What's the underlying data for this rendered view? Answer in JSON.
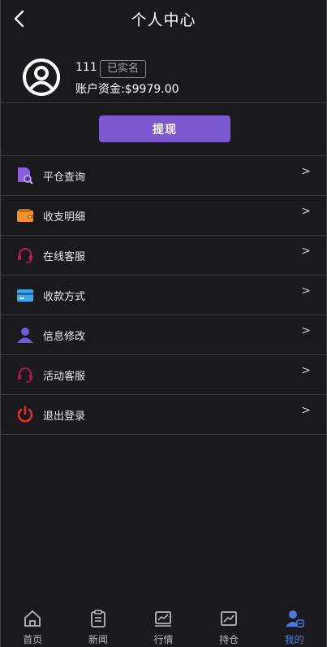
{
  "header": {
    "title": "个人中心"
  },
  "profile": {
    "user_id": "111",
    "verify_status": "已实名",
    "balance_text": "账户资金:$9979.00"
  },
  "actions": {
    "withdraw_label": "提现"
  },
  "menu": {
    "arrow": ">",
    "items": [
      {
        "label": "平仓查询",
        "icon": "search-document-icon"
      },
      {
        "label": "收支明细",
        "icon": "wallet-icon"
      },
      {
        "label": "在线客服",
        "icon": "headset-icon"
      },
      {
        "label": "收款方式",
        "icon": "credit-card-icon"
      },
      {
        "label": "信息修改",
        "icon": "user-icon"
      },
      {
        "label": "活动客服",
        "icon": "headset-icon"
      },
      {
        "label": "退出登录",
        "icon": "power-icon"
      }
    ]
  },
  "tabbar": {
    "tabs": [
      {
        "label": "首页",
        "icon": "home-icon"
      },
      {
        "label": "新闻",
        "icon": "clipboard-icon"
      },
      {
        "label": "行情",
        "icon": "chart-icon"
      },
      {
        "label": "持仓",
        "icon": "trend-icon"
      },
      {
        "label": "我的",
        "icon": "profile-icon",
        "active": true
      }
    ]
  },
  "colors": {
    "background": "#1a1a1d",
    "accent_purple": "#7b58d0",
    "active_tab": "#4a7ae0",
    "divider": "#3a3a3e"
  }
}
